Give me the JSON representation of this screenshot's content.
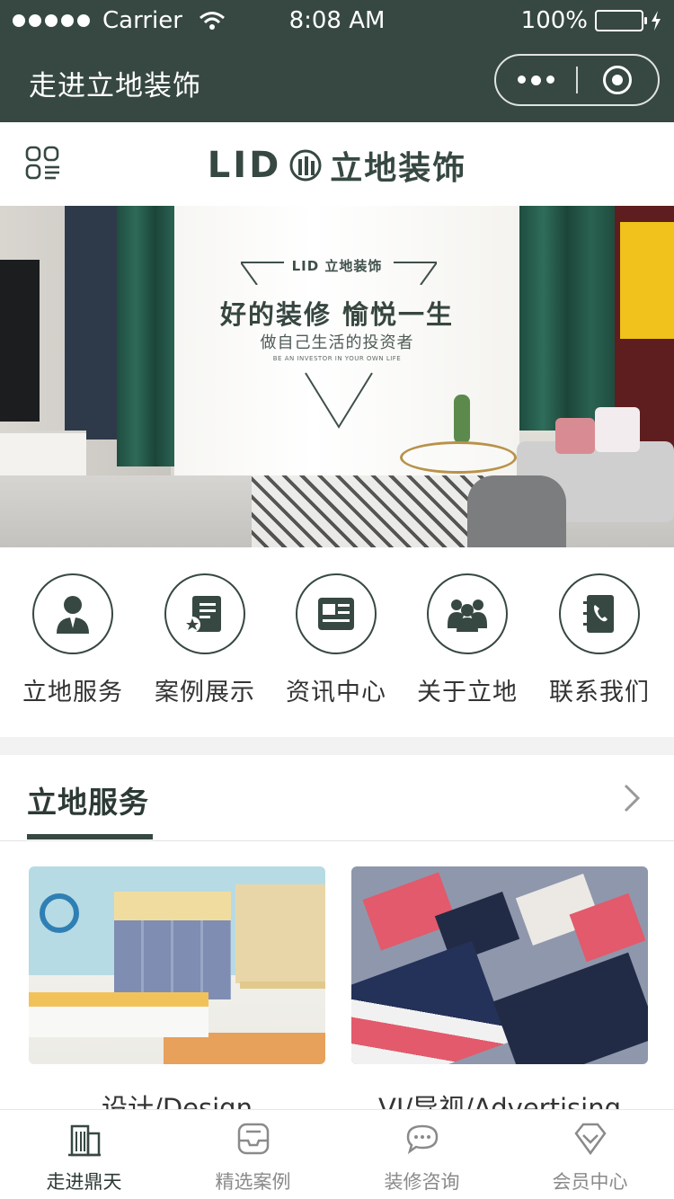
{
  "status_bar": {
    "carrier": "Carrier",
    "time": "8:08 AM",
    "battery": "100%",
    "battery_level": 1.0
  },
  "nav_bar": {
    "title": "走进立地装饰"
  },
  "header": {
    "logo_en": "LID",
    "logo_cn": "立地装饰"
  },
  "banner": {
    "brand": "LID 立地装饰",
    "slogan": "好的装修 愉悦一生",
    "subtitle": "做自己生活的投资者",
    "english": "BE AN INVESTOR IN YOUR OWN LIFE"
  },
  "icon_nav": [
    {
      "label": "立地服务",
      "icon": "service-person-icon"
    },
    {
      "label": "案例展示",
      "icon": "case-book-icon"
    },
    {
      "label": "资讯中心",
      "icon": "news-icon"
    },
    {
      "label": "关于立地",
      "icon": "team-icon"
    },
    {
      "label": "联系我们",
      "icon": "phone-book-icon"
    }
  ],
  "section": {
    "title": "立地服务"
  },
  "cards": [
    {
      "title": "设计/Design",
      "image": "bedroom-design-photo"
    },
    {
      "title": "VI/导视/Advertising",
      "image": "vi-branding-photo"
    }
  ],
  "tab_bar": [
    {
      "label": "走进鼎天",
      "icon": "building-icon",
      "active": true
    },
    {
      "label": "精选案例",
      "icon": "inbox-icon",
      "active": false
    },
    {
      "label": "装修咨询",
      "icon": "chat-icon",
      "active": false
    },
    {
      "label": "会员中心",
      "icon": "diamond-icon",
      "active": false
    }
  ],
  "colors": {
    "brand_dark_green": "#364841",
    "accent_green": "#4cd964"
  }
}
